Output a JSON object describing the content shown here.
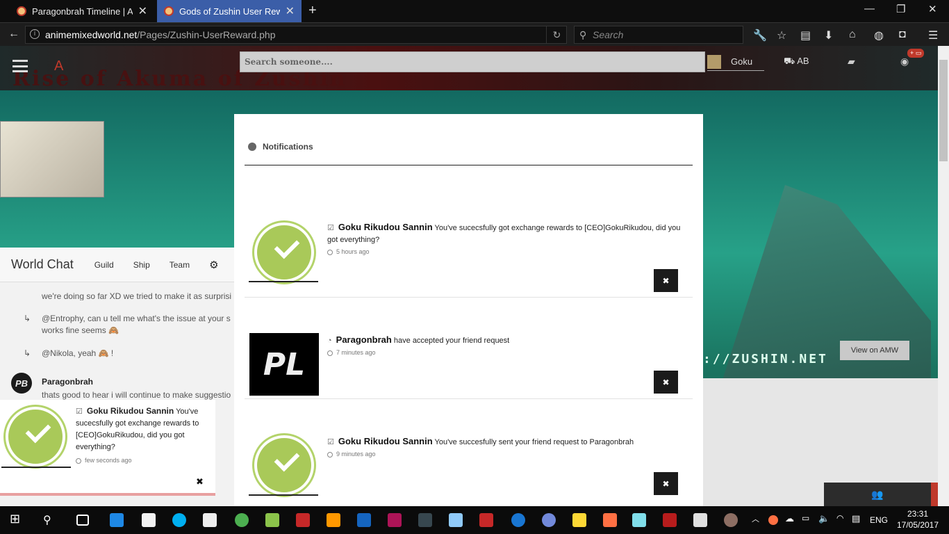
{
  "browser": {
    "tabs": [
      {
        "title": "Paragonbrah Timeline | AMW"
      },
      {
        "title": "Gods of Zushin User Reward"
      }
    ],
    "url_domain": "animemixedworld.net",
    "url_path": "/Pages/Zushin-UserReward.php",
    "search_placeholder": "Search"
  },
  "site": {
    "banner_text": "Rise of Akuma of Zushin",
    "search_placeholder": "Search someone....",
    "user_name": "Goku",
    "ab_label": "AB",
    "view_button": "View on AMW",
    "watermark": "://ZUSHIN.NET"
  },
  "chat": {
    "title": "World Chat",
    "tabs": [
      "Guild",
      "Ship",
      "Team"
    ],
    "messages": [
      {
        "text": "we're doing so far XD we tried to make it as surprisi"
      },
      {
        "text": "@Entrophy, can u tell me what's the issue at your s works fine seems 🙈"
      },
      {
        "text": "@Nikola, yeah 🙈 !"
      }
    ],
    "author": "Paragonbrah",
    "author_msg": "thats good to hear i will continue to make suggestio"
  },
  "modal": {
    "title": "Notifications",
    "items": [
      {
        "name": "Goku Rikudou Sannin",
        "text": "You've sucecsfully got exchange rewards to [CEO]GokuRikudou, did you got everything?",
        "time": "5 hours ago"
      },
      {
        "name": "Paragonbrah",
        "text": "have accepted your friend request",
        "time": "7 minutes ago"
      },
      {
        "name": "Goku Rikudou Sannin",
        "text": "You've succesfully sent your friend request to Paragonbrah",
        "time": "9 minutes ago"
      }
    ],
    "close_glyph": "✖"
  },
  "popup": {
    "name": "Goku Rikudou Sannin",
    "text": "You've sucecsfully got exchange rewards to [CEO]GokuRikudou, did you got everything?",
    "time": "few seconds ago",
    "close_glyph": "✖"
  },
  "taskbar": {
    "lang": "ENG",
    "time": "23:31",
    "date": "17/05/2017"
  }
}
